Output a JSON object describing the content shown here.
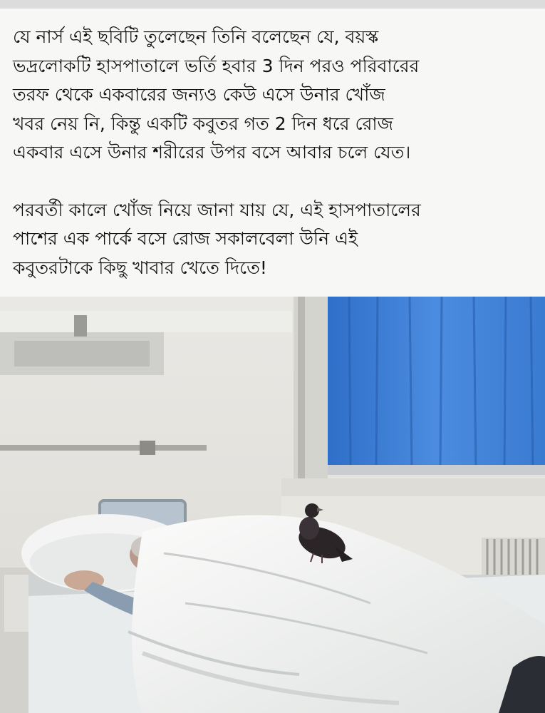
{
  "post": {
    "paragraph_1": "যে নার্স এই ছবিটি তুলেছেন তিনি বলেছেন যে, বয়স্ক\nভদ্রলোকটি হাসপাতালে ভর্তি হবার 3 দিন পরও পরিবারের\nতরফ থেকে একবারের জন্যও কেউ এসে উনার খোঁজ\nখবর নেয় নি, কিন্তু একটি কবুতর গত 2 দিন ধরে রোজ\nএকবার এসে উনার শরীরের উপর বসে আবার  চলে যেত।",
    "paragraph_2": "পরবর্তী কালে খোঁজ নিয়ে জানা যায় যে, এই হাসপাতালের\nপাশের এক পার্কে বসে  রোজ সকালবেলা উনি এই\nকবুতরটাকে কিছু খাবার খেতে দিতে!"
  },
  "photo": {
    "colors": {
      "wall": "#e6e5e0",
      "curtain": "#3f7fd6",
      "blanket": "#f2f3f1",
      "pigeon": "#2b2528"
    }
  }
}
